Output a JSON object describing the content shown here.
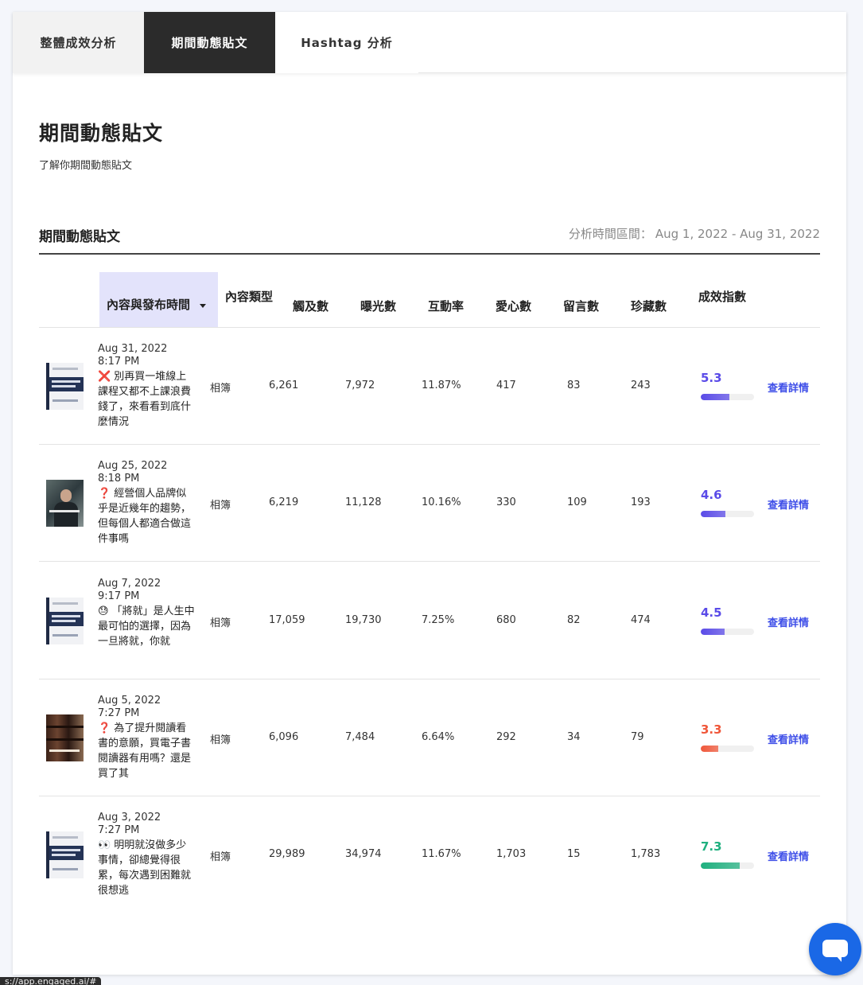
{
  "tabs": [
    {
      "label": "整體成效分析",
      "active": false
    },
    {
      "label": "期間動態貼文",
      "active": true
    },
    {
      "label": "Hashtag 分析",
      "active": false
    }
  ],
  "page": {
    "title": "期間動態貼文",
    "subtitle": "了解你期間動態貼文"
  },
  "section": {
    "title": "期間動態貼文",
    "date_label": "分析時間區間：",
    "date_range": "Aug 1, 2022 - Aug 31, 2022"
  },
  "columns": {
    "content": "內容與發布時間",
    "type": "內容類型",
    "reach": "觸及數",
    "impressions": "曝光數",
    "engagement": "互動率",
    "likes": "愛心數",
    "comments": "留言數",
    "saves": "珍藏數",
    "score": "成效指數"
  },
  "rows": [
    {
      "date": "Aug 31, 2022",
      "time": "8:17 PM",
      "emoji": "❌",
      "title": "別再買一堆線上課程又都不上課浪費錢了，來看看到底什麼情況",
      "type": "相簿",
      "reach": "6,261",
      "impressions": "7,972",
      "engagement": "11.87%",
      "likes": "417",
      "comments": "83",
      "saves": "243",
      "score": "5.3",
      "score_value": 5.3,
      "score_color": "#5a4be8",
      "detail": "查看詳情"
    },
    {
      "date": "Aug 25, 2022",
      "time": "8:18 PM",
      "emoji": "❓",
      "title": "經營個人品牌似乎是近幾年的趨勢，但每個人都適合做這件事嗎",
      "type": "相簿",
      "reach": "6,219",
      "impressions": "11,128",
      "engagement": "10.16%",
      "likes": "330",
      "comments": "109",
      "saves": "193",
      "score": "4.6",
      "score_value": 4.6,
      "score_color": "#5a4be8",
      "detail": "查看詳情"
    },
    {
      "date": "Aug 7, 2022",
      "time": "9:17 PM",
      "emoji": "😓",
      "title": "「將就」是人生中最可怕的選擇，因為一旦將就，你就",
      "type": "相簿",
      "reach": "17,059",
      "impressions": "19,730",
      "engagement": "7.25%",
      "likes": "680",
      "comments": "82",
      "saves": "474",
      "score": "4.5",
      "score_value": 4.5,
      "score_color": "#5a4be8",
      "detail": "查看詳情"
    },
    {
      "date": "Aug 5, 2022",
      "time": "7:27 PM",
      "emoji": "❓",
      "title": "為了提升閱讀看書的意願，買電子書閱讀器有用嗎？還是買了其",
      "type": "相簿",
      "reach": "6,096",
      "impressions": "7,484",
      "engagement": "6.64%",
      "likes": "292",
      "comments": "34",
      "saves": "79",
      "score": "3.3",
      "score_value": 3.3,
      "score_color": "#f0573a",
      "detail": "查看詳情"
    },
    {
      "date": "Aug 3, 2022",
      "time": "7:27 PM",
      "emoji": "👀",
      "title": "明明就沒做多少事情，卻總覺得很累，每次遇到困難就很想逃",
      "type": "相簿",
      "reach": "29,989",
      "impressions": "34,974",
      "engagement": "11.67%",
      "likes": "1,703",
      "comments": "15",
      "saves": "1,783",
      "score": "7.3",
      "score_value": 7.3,
      "score_color": "#1fb07f",
      "detail": "查看詳情"
    }
  ],
  "status_url": "s://app.engaged.ai/#"
}
